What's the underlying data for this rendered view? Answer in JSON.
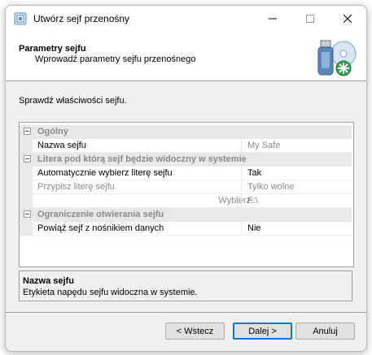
{
  "window": {
    "title": "Utwórz sejf przenośny"
  },
  "header": {
    "title": "Parametry sejfu",
    "subtitle": "Wprowadź parametry sejfu przenośnego",
    "graphic_icon": "usb-drive-disc-icon"
  },
  "intro": "Sprawdź właściwości sejfu.",
  "grid": {
    "categories": [
      {
        "label": "Ogólny"
      },
      {
        "label": "Litera pod którą sejf będzie widoczny w systemie"
      },
      {
        "label": "Ograniczenie otwierania sejfu"
      }
    ],
    "rows": [
      {
        "name": "Nazwa sejfu",
        "value": "My Safe"
      },
      {
        "name": "Automatycznie wybierz literę sejfu",
        "value": "Tak"
      },
      {
        "name": "Przypisz literę sejfu",
        "value": "Tylko wolne"
      },
      {
        "name": "Wybierz:",
        "value": "F:\\"
      },
      {
        "name": "Powiąż sejf z nośnikiem danych",
        "value": "Nie"
      }
    ]
  },
  "help": {
    "title": "Nazwa sejfu",
    "description": "Etykieta napędu sejfu widoczna w systemie."
  },
  "buttons": {
    "back": "< Wstecz",
    "next": "Dalej >",
    "cancel": "Anuluj"
  },
  "colors": {
    "accent": "#0078d7",
    "category_bg": "#e8e8e8",
    "border": "#a0a0a0"
  }
}
